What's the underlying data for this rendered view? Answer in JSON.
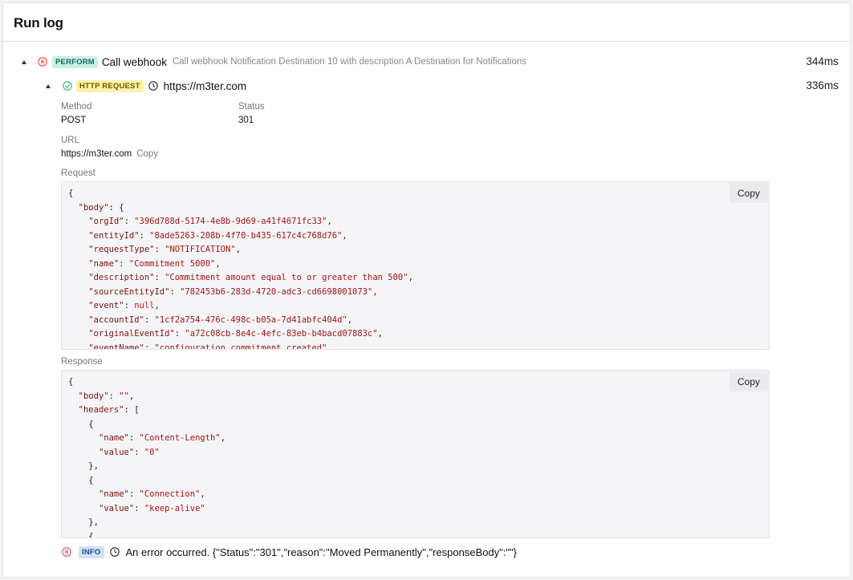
{
  "panel": {
    "title": "Run log"
  },
  "perform": {
    "badge": "PERFORM",
    "title": "Call webhook",
    "description": "Call webhook Notification Destination 10 with description A Destination for Notifications",
    "duration": "344ms",
    "status_icon": "error-circle-icon"
  },
  "http": {
    "badge": "HTTP REQUEST",
    "url_title": "https://m3ter.com",
    "duration": "336ms",
    "status_icon": "success-circle-icon",
    "method_label": "Method",
    "method_value": "POST",
    "status_label": "Status",
    "status_value": "301",
    "url_label": "URL",
    "url_value": "https://m3ter.com",
    "url_copy": "Copy",
    "request_label": "Request",
    "request_copy": "Copy",
    "request_lines": [
      "{",
      "  \"body\": {",
      "    \"orgId\": \"396d788d-5174-4e8b-9d69-a41f4671fc33\",",
      "    \"entityId\": \"8ade5263-208b-4f70-b435-617c4c768d76\",",
      "    \"requestType\": \"NOTIFICATION\",",
      "    \"name\": \"Commitment 5000\",",
      "    \"description\": \"Commitment amount equal to or greater than 500\",",
      "    \"sourceEntityId\": \"782453b6-283d-4720-adc3-cd6698001073\",",
      "    \"event\": null,",
      "    \"accountId\": \"1cf2a754-476c-498c-b05a-7d41abfc404d\",",
      "    \"originalEventId\": \"a72c08cb-8e4c-4efc-83eb-b4bacd07883c\",",
      "    \"eventName\": \"configuration.commitment.created\","
    ],
    "response_label": "Response",
    "response_copy": "Copy",
    "response_lines": [
      "{",
      "  \"body\": \"\",",
      "  \"headers\": [",
      "    {",
      "      \"name\": \"Content-Length\",",
      "      \"value\": \"0\"",
      "    },",
      "    {",
      "      \"name\": \"Connection\",",
      "      \"value\": \"keep-alive\"",
      "    },",
      "    {"
    ]
  },
  "info": {
    "badge": "INFO",
    "message": "An error occurred. {\"Status\":\"301\",\"reason\":\"Moved Permanently\",\"responseBody\":\"\"}",
    "status_icon": "error-circle-icon"
  },
  "colors": {
    "error": "#e5484d",
    "success": "#2fb36f",
    "perform_badge": "#c7f0e6",
    "http_badge": "#fbf2a8",
    "info_badge": "#cfe2f7"
  }
}
